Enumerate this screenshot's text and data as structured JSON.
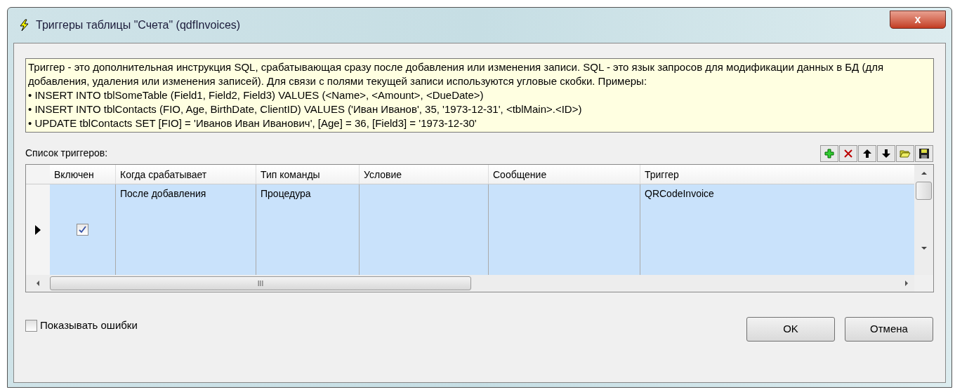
{
  "window": {
    "title": "Триггеры таблицы \"Счета\" (qdfInvoices)",
    "close": "x"
  },
  "info": {
    "paragraph": "Триггер - это дополнительная инструкция SQL, срабатывающая сразу после добавления или изменения записи. SQL - это язык запросов для модификации данных в БД (для добавления, удаления или изменения записей). Для связи с полями текущей записи используются угловые скобки. Примеры:",
    "examples": [
      "• INSERT INTO tblSomeTable (Field1, Field2, Field3) VALUES (<Name>, <Amount>, <DueDate>)",
      "• INSERT INTO tblContacts (FIO, Age, BirthDate, ClientID) VALUES ('Иван Иванов', 35, '1973-12-31', <tblMain>.<ID>)",
      "• UPDATE tblContacts SET [FIO] = 'Иванов Иван Иванович', [Age] = 36, [Field3] = '1973-12-30'"
    ]
  },
  "list_label": "Список триггеров:",
  "toolbar": [
    {
      "kind": "add"
    },
    {
      "kind": "delete"
    },
    {
      "kind": "up"
    },
    {
      "kind": "down"
    },
    {
      "kind": "open"
    },
    {
      "kind": "save"
    }
  ],
  "table": {
    "columns": [
      "Включен",
      "Когда срабатывает",
      "Тип команды",
      "Условие",
      "Сообщение",
      "Триггер"
    ],
    "rows": [
      {
        "selected": true,
        "current": true,
        "enabled": true,
        "when": "После добавления",
        "type": "Процедура",
        "condition": "",
        "message": "",
        "trigger": "QRCodeInvoice"
      }
    ],
    "hscroll_grip": "III"
  },
  "show_errors": {
    "label": "Показывать ошибки",
    "checked": false
  },
  "buttons": [
    "OK",
    "Отмена"
  ]
}
